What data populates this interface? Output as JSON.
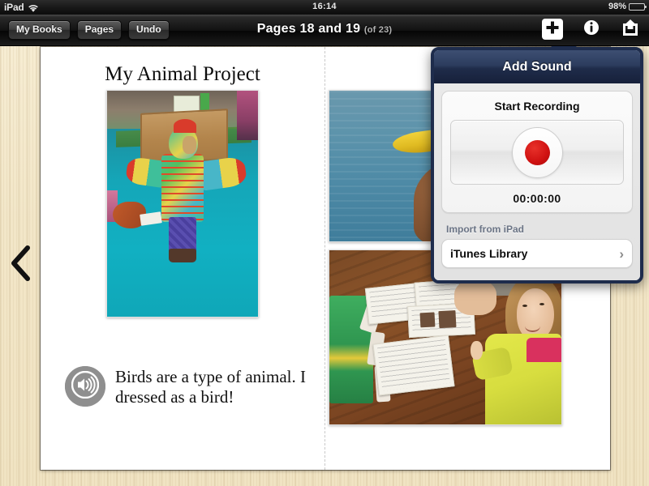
{
  "status_bar": {
    "device": "iPad",
    "wifi_icon": "wifi-icon",
    "time": "16:14",
    "battery_percent": "98%",
    "battery_level": 98
  },
  "toolbar": {
    "my_books_label": "My Books",
    "pages_label": "Pages",
    "undo_label": "Undo",
    "title": "Pages 18 and 19",
    "title_sub": "(of 23)",
    "add_icon": "plus-icon",
    "info_icon": "info-icon",
    "share_icon": "share-icon"
  },
  "navigation": {
    "prev_icon": "chevron-left-icon"
  },
  "book": {
    "title": "My Animal Project",
    "caption": "Birds are a type of animal. I dressed as a bird!",
    "speaker_icon": "speaker-icon",
    "photos": [
      {
        "name": "photo-bird-costume",
        "alt": "Child wearing a colorful handmade bird costume standing on teal carpet in a classroom"
      },
      {
        "name": "photo-mallard-duck",
        "alt": "Close-up of a mallard duck with green head and yellow bill on blue water"
      },
      {
        "name": "photo-classroom-worksheets",
        "alt": "Girl in a yellow sweater smiling at a desk covered with animal classification worksheets"
      }
    ]
  },
  "popover": {
    "title": "Add Sound",
    "record_label": "Start Recording",
    "record_icon": "record-dot-icon",
    "timer": "00:00:00",
    "import_section_label": "Import from iPad",
    "itunes_label": "iTunes Library",
    "chevron_icon": "chevron-right-icon"
  },
  "colors": {
    "popover_border": "#1e2c4c",
    "popover_header_top": "#3d4f72",
    "record_red": "#cf1111",
    "desk_background": "#f2e6c8",
    "page_white": "#ffffff"
  }
}
